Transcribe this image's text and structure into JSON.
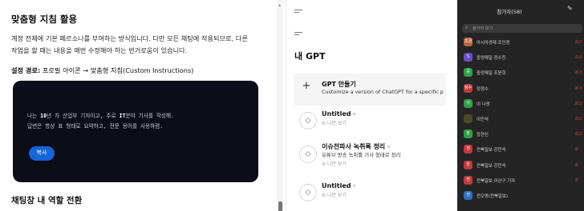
{
  "doc": {
    "title": "맞춤형 지침 활용",
    "paragraph_line1": "계정 전체에 기본 페르소나를 부여하는 방식입니다. 다만 모든 채팅에 적용되므로, 다른",
    "paragraph_line2": "작업을 할 때는 내용을 매번 수정해야 하는 번거로움이 있습니다.",
    "path_label": "설정 경로:",
    "path_value": " 프로필 아이콘 → 맞춤형 지침(Custom Instructions)",
    "code": {
      "line1_a": "나는 ",
      "line1_b": "10",
      "line1_c": "년 차 산업부 기자이고, 주로 ",
      "line1_d": "IT",
      "line1_e": "분야 기사를 작성해.",
      "line2": "답변은 항상 표 형태로 요약하고, 전문 용어를 사용하렴."
    },
    "copy_label": "복사",
    "next_heading": "채팅창 내 역할 전환"
  },
  "gpt": {
    "heading": "내 GPT",
    "create": {
      "title": "GPT 만들기",
      "desc": "Customize a version of ChatGPT for a specific p"
    },
    "items": [
      {
        "title": "Untitled",
        "desc": "",
        "sub": "나만 보기"
      },
      {
        "title": "이슈전파사 녹취록 정리",
        "desc": "유튜브 방송 녹취를 기사 형태로 정리",
        "sub": "나만 보기"
      },
      {
        "title": "Untitled",
        "desc": "",
        "sub": "나만 보기"
      }
    ]
  },
  "participants": {
    "title": "참가자(58)",
    "search_placeholder": "참가자 보기",
    "list": [
      {
        "avatar": "조경",
        "name": "아시아경제 조인경",
        "tag": "호스",
        "color": "#b8643c"
      },
      {
        "avatar": "S",
        "name": "중앙매일 정수진",
        "tag": "호스",
        "color": "#6a4fc8"
      },
      {
        "avatar": "중",
        "name": "중앙매일 조윤희",
        "tag": "호스",
        "color": "#2f9e44"
      },
      {
        "avatar": "정수",
        "name": "정정수",
        "tag": "호스",
        "color": "#c03a3a"
      },
      {
        "avatar": "이",
        "name": "이 나경",
        "tag": "호스",
        "color": "#2f9e44"
      },
      {
        "avatar": "",
        "name": "이민석",
        "tag": "호스",
        "color": "#4a4a2a"
      },
      {
        "avatar": "장",
        "name": "장현신",
        "tag": "호스",
        "color": "#2f9e44"
      },
      {
        "avatar": "전",
        "name": "전북일보 강민석",
        "tag": "호",
        "color": "#c03a3a"
      },
      {
        "avatar": "한",
        "name": "전북일보 강민석",
        "tag": "호",
        "color": "#c03a3a"
      },
      {
        "avatar": "전",
        "name": "전북일보 이상구 기자",
        "tag": "호",
        "color": "#c03a3a"
      },
      {
        "avatar": "전",
        "name": "전오영(전북일보)",
        "tag": "",
        "color": "#2d6fbf"
      }
    ]
  }
}
